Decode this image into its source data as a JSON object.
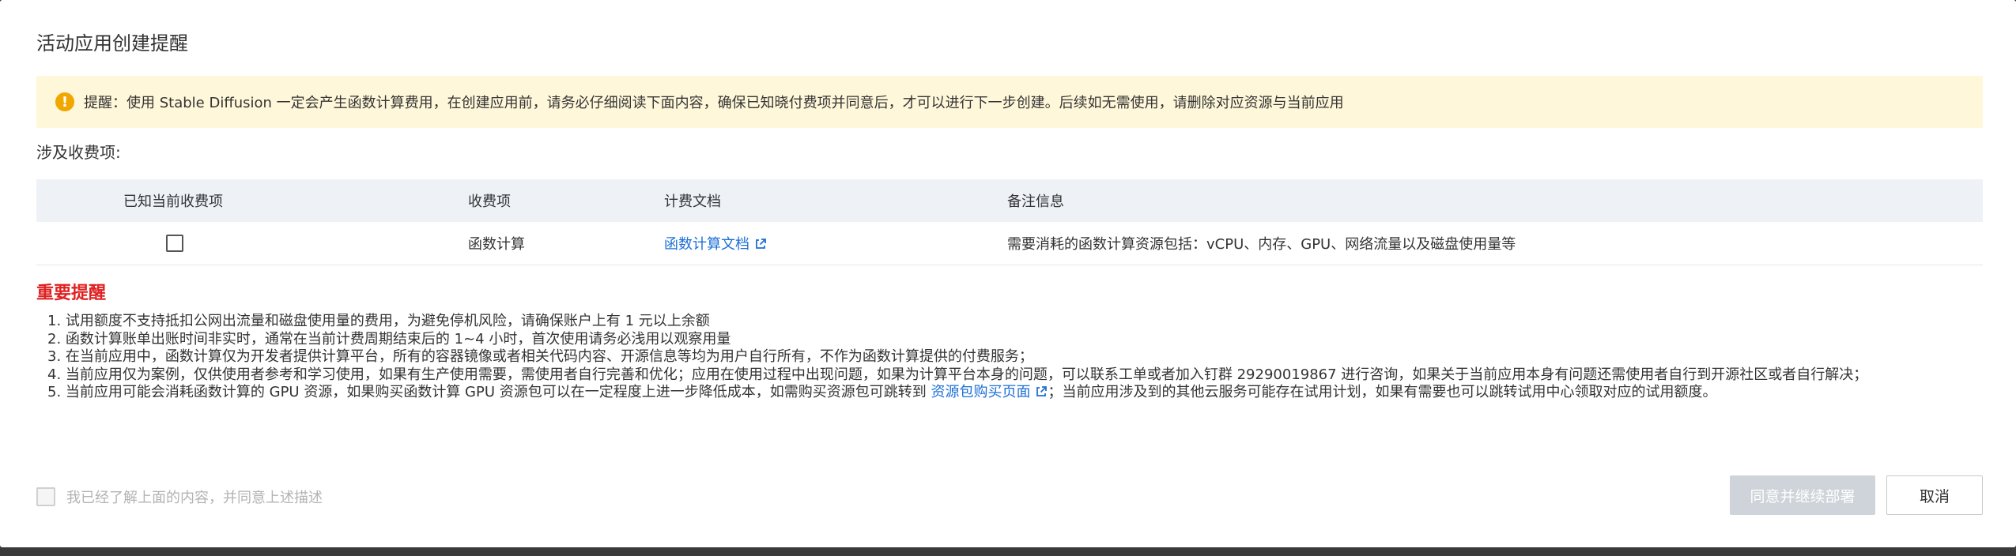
{
  "dialog": {
    "title": "活动应用创建提醒"
  },
  "alert": {
    "icon": "warning-icon",
    "text": "提醒：使用 Stable Diffusion 一定会产生函数计算费用，在创建应用前，请务必仔细阅读下面内容，确保已知晓付费项并同意后，才可以进行下一步创建。后续如无需使用，请删除对应资源与当前应用"
  },
  "fees": {
    "section_title": "涉及收费项:",
    "headers": [
      "已知当前收费项",
      "收费项",
      "计费文档",
      "备注信息"
    ],
    "rows": [
      {
        "acknowledged": false,
        "item": "函数计算",
        "doc_link": "函数计算文档",
        "remark": "需要消耗的函数计算资源包括：vCPU、内存、GPU、网络流量以及磁盘使用量等"
      }
    ]
  },
  "important": {
    "title": "重要提醒",
    "notes": [
      "1. 试用额度不支持抵扣公网出流量和磁盘使用量的费用，为避免停机风险，请确保账户上有 1 元以上余额",
      "2. 函数计算账单出账时间非实时，通常在当前计费周期结束后的 1~4 小时，首次使用请务必浅用以观察用量",
      "3. 在当前应用中，函数计算仅为开发者提供计算平台，所有的容器镜像或者相关代码内容、开源信息等均为用户自行所有，不作为函数计算提供的付费服务；",
      "4. 当前应用仅为案例，仅供使用者参考和学习使用，如果有生产使用需要，需使用者自行完善和优化；应用在使用过程中出现问题，如果为计算平台本身的问题，可以联系工单或者加入钉群 29290019867 进行咨询，如果关于当前应用本身有问题还需使用者自行到开源社区或者自行解决；"
    ],
    "note5_before": "5. 当前应用可能会消耗函数计算的 GPU 资源，如果购买函数计算 GPU 资源包可以在一定程度上进一步降低成本，如需购买资源包可跳转到 ",
    "note5_link": "资源包购买页面",
    "note5_after": "；当前应用涉及到的其他云服务可能存在试用计划，如果有需要也可以跳转试用中心领取对应的试用额度。"
  },
  "footer": {
    "agree_label": "我已经了解上面的内容，并同意上述描述",
    "agree_checked": false,
    "confirm_label": "同意并继续部署",
    "cancel_label": "取消"
  },
  "colors": {
    "alert_bg": "#fff7d9",
    "alert_icon": "#f0a800",
    "important": "#e02020",
    "link": "#1c6fd6",
    "table_header_bg": "#eef2f7",
    "disabled_button": "#cfd4da"
  }
}
